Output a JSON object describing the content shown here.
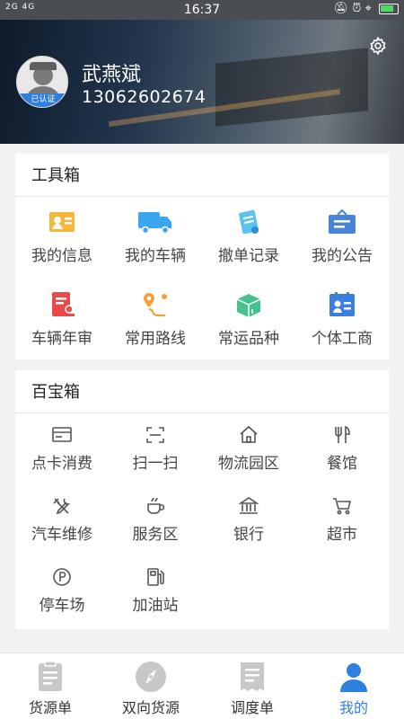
{
  "status": {
    "left": "2G 4G",
    "time": "16:37"
  },
  "profile": {
    "name": "武燕斌",
    "phone": "13062602674",
    "badge": "已认证"
  },
  "toolbox": {
    "title": "工具箱",
    "items": [
      {
        "label": "我的信息",
        "icon": "id-card-icon",
        "color": "#f5b73b"
      },
      {
        "label": "我的车辆",
        "icon": "truck-icon",
        "color": "#3aa6f0"
      },
      {
        "label": "撤单记录",
        "icon": "clipboard-icon",
        "color": "#5bc2f2"
      },
      {
        "label": "我的公告",
        "icon": "notice-icon",
        "color": "#4a84d8"
      },
      {
        "label": "车辆年审",
        "icon": "inspection-icon",
        "color": "#e84a4a"
      },
      {
        "label": "常用路线",
        "icon": "route-icon",
        "color": "#f0a23a"
      },
      {
        "label": "常运品种",
        "icon": "cargo-box-icon",
        "color": "#46c28e"
      },
      {
        "label": "个体工商",
        "icon": "business-card-icon",
        "color": "#3a7fe0"
      }
    ]
  },
  "treasure": {
    "title": "百宝箱",
    "items": [
      {
        "label": "点卡消费",
        "icon": "card-icon"
      },
      {
        "label": "扫一扫",
        "icon": "scan-icon"
      },
      {
        "label": "物流园区",
        "icon": "home-icon"
      },
      {
        "label": "餐馆",
        "icon": "restaurant-icon"
      },
      {
        "label": "汽车维修",
        "icon": "wrench-icon"
      },
      {
        "label": "服务区",
        "icon": "coffee-icon"
      },
      {
        "label": "银行",
        "icon": "bank-icon"
      },
      {
        "label": "超市",
        "icon": "cart-icon"
      },
      {
        "label": "停车场",
        "icon": "parking-icon"
      },
      {
        "label": "加油站",
        "icon": "fuel-icon"
      }
    ]
  },
  "tabs": [
    {
      "label": "货源单",
      "icon": "cargo-list-icon"
    },
    {
      "label": "双向货源",
      "icon": "compass-icon"
    },
    {
      "label": "调度单",
      "icon": "dispatch-icon"
    },
    {
      "label": "我的",
      "icon": "person-icon",
      "active": true
    }
  ],
  "colors": {
    "accent": "#2f7fe0",
    "inactive_icon": "#c8c8c8",
    "line_icon": "#555555"
  }
}
